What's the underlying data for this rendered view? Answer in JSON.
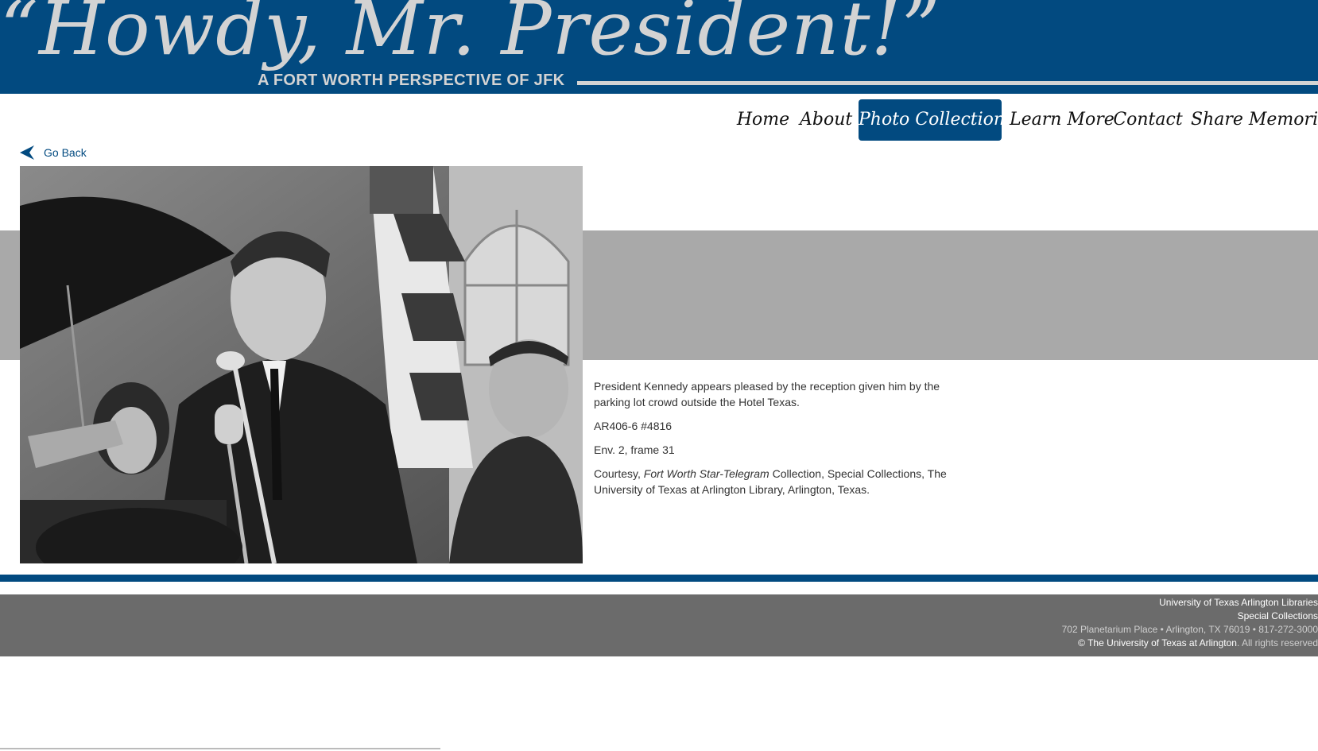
{
  "header": {
    "title": "“Howdy, Mr. President!”",
    "subtitle": "A FORT WORTH PERSPECTIVE OF JFK"
  },
  "nav": {
    "items": [
      {
        "label": "Home"
      },
      {
        "label": "About"
      },
      {
        "label": "Photo Collection",
        "active": true
      },
      {
        "label": "Learn More"
      },
      {
        "label": "Contact"
      },
      {
        "label": "Share Memories"
      }
    ]
  },
  "go_back": {
    "label": "Go Back"
  },
  "caption": {
    "description": "President Kennedy appears pleased by the reception given him by the parking lot crowd outside the Hotel Texas.",
    "id": "AR406-6 #4816",
    "frame": "Env. 2, frame 31",
    "courtesy_prefix": "Courtesy, ",
    "courtesy_collection": "Fort Worth Star-Telegram",
    "courtesy_suffix": " Collection, Special Collections, The University of Texas at Arlington Library, Arlington, Texas."
  },
  "footer": {
    "line1": "University of Texas Arlington Libraries",
    "line2": "Special Collections",
    "line3": "702 Planetarium Place • Arlington, TX 76019 • 817-272-3000",
    "copyright_link": "© The University of Texas at Arlington",
    "rights": ". All rights reserved"
  },
  "colors": {
    "brand_blue": "#024a80",
    "band_gray": "#a9a9a9",
    "footer_gray": "#6b6b6b"
  }
}
